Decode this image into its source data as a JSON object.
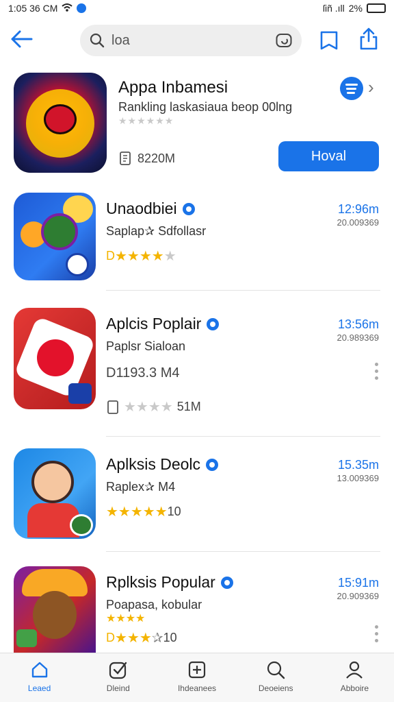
{
  "status_bar": {
    "time": "1:05 36 CM",
    "signal": "ſiñ .ıll",
    "battery_text": "2%",
    "battery_level": 0.9
  },
  "search": {
    "value": "loa"
  },
  "featured": {
    "title": "Appa Inbamesi",
    "subtitle": "Rankling laskasiaua beop 00lng",
    "rating_stars": "★★★★★★",
    "size": "8220M",
    "install_label": "Hoval"
  },
  "apps": [
    {
      "title": "Unaodbiei",
      "subtitle": "Saplap✰ Sdfollasr",
      "rating_prefix": "D",
      "stars_gold": "★★★★",
      "stars_grey": "★",
      "rating_suffix": "",
      "time": "12:96m",
      "count": "20.009369",
      "size": "",
      "extra": ""
    },
    {
      "title": "Aplcis Poplair",
      "subtitle": "Paplsr Sialoan",
      "rating_prefix": "D1193.3 M4",
      "stars_gold": "",
      "stars_grey": "",
      "rating_suffix": "",
      "time": "13:56m",
      "count": "20.989369",
      "size": "",
      "extra": "51M"
    },
    {
      "title": "Aplksis Deolc",
      "subtitle": "Raplex✰ M4",
      "rating_prefix": "",
      "stars_gold": "★★★★★",
      "stars_grey": "",
      "rating_suffix": "10",
      "time": "15.35m",
      "count": "13.009369",
      "size": "",
      "extra": ""
    },
    {
      "title": "Rplksis Popular",
      "subtitle": "Poapasa, kobular",
      "rating_prefix": "D",
      "stars_gold": "★★★",
      "stars_grey": "✰",
      "rating_suffix": "10",
      "time": "15:91m",
      "count": "20.909369",
      "size": "",
      "extra": ""
    }
  ],
  "tabs": [
    {
      "label": "Leaed"
    },
    {
      "label": "Dleind"
    },
    {
      "label": "Ihdeanees"
    },
    {
      "label": "Deoeiens"
    },
    {
      "label": "Abboire"
    }
  ],
  "colors": {
    "accent": "#1a73e8",
    "star": "#f4b400"
  }
}
